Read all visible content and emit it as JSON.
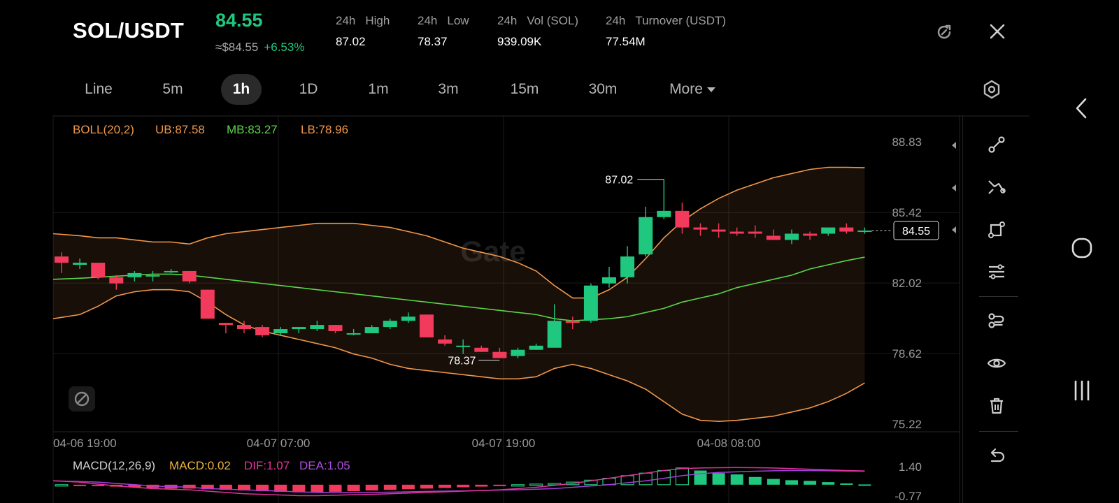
{
  "header": {
    "pair": "SOL/USDT",
    "price": "84.55",
    "approx": "≈$84.55",
    "change": "+6.53%",
    "stats": [
      {
        "period": "24h",
        "label": "High",
        "value": "87.02"
      },
      {
        "period": "24h",
        "label": "Low",
        "value": "78.37"
      },
      {
        "period": "24h",
        "label": "Vol (SOL)",
        "value": "939.09K"
      },
      {
        "period": "24h",
        "label": "Turnover (USDT)",
        "value": "77.54M"
      }
    ]
  },
  "timeframes": [
    "Line",
    "5m",
    "1h",
    "1D",
    "1m",
    "3m",
    "15m",
    "30m",
    "More"
  ],
  "active_timeframe": "1h",
  "indicators": {
    "boll": {
      "name": "BOLL(20,2)",
      "ub": "UB:87.58",
      "mb": "MB:83.27",
      "lb": "LB:78.96"
    },
    "macd": {
      "name": "MACD(12,26,9)",
      "macd": "MACD:0.02",
      "dif": "DIF:1.07",
      "dea": "DEA:1.05"
    }
  },
  "watermark": "Gate",
  "chart_data": {
    "type": "candlestick",
    "y_ticks": [
      "88.83",
      "85.42",
      "82.02",
      "78.62",
      "75.22"
    ],
    "ylim": [
      75.22,
      88.83
    ],
    "x_ticks": [
      "04-06 19:00",
      "04-07 07:00",
      "04-07 19:00",
      "04-08 08:00"
    ],
    "high_marker": "87.02",
    "low_marker": "78.37",
    "last_price_tag": "84.55",
    "macd_ticks": [
      "1.40",
      "-0.77"
    ],
    "candles": [
      [
        83.3,
        83.5,
        82.5,
        83.0
      ],
      [
        82.9,
        83.2,
        82.7,
        83.0
      ],
      [
        83.0,
        83.0,
        82.2,
        82.3
      ],
      [
        82.3,
        82.4,
        81.7,
        82.0
      ],
      [
        82.3,
        82.6,
        82.1,
        82.5
      ],
      [
        82.4,
        82.6,
        82.1,
        82.4
      ],
      [
        82.6,
        82.7,
        82.5,
        82.6
      ],
      [
        82.6,
        82.6,
        82.0,
        82.1
      ],
      [
        81.7,
        81.7,
        80.3,
        80.3
      ],
      [
        80.1,
        80.1,
        79.6,
        80.0
      ],
      [
        80.0,
        80.2,
        79.6,
        79.8
      ],
      [
        79.9,
        80.0,
        79.4,
        79.5
      ],
      [
        79.6,
        79.9,
        79.5,
        79.8
      ],
      [
        79.8,
        79.9,
        79.6,
        79.9
      ],
      [
        79.8,
        80.2,
        79.7,
        80.0
      ],
      [
        80.0,
        80.0,
        79.6,
        79.7
      ],
      [
        79.6,
        79.8,
        79.5,
        79.6
      ],
      [
        79.6,
        80.0,
        79.6,
        79.9
      ],
      [
        79.9,
        80.3,
        79.8,
        80.2
      ],
      [
        80.2,
        80.6,
        80.1,
        80.4
      ],
      [
        80.5,
        80.5,
        79.4,
        79.4
      ],
      [
        79.3,
        79.5,
        79.0,
        79.1
      ],
      [
        79.0,
        79.3,
        78.6,
        79.0
      ],
      [
        78.9,
        79.0,
        78.7,
        78.7
      ],
      [
        78.7,
        78.9,
        78.4,
        78.4
      ],
      [
        78.5,
        78.9,
        78.4,
        78.8
      ],
      [
        78.8,
        79.1,
        78.8,
        79.0
      ],
      [
        78.9,
        81.0,
        78.9,
        80.2
      ],
      [
        80.2,
        80.4,
        79.8,
        80.1
      ],
      [
        80.2,
        82.0,
        80.1,
        81.9
      ],
      [
        82.0,
        82.8,
        81.8,
        82.3
      ],
      [
        82.3,
        83.8,
        82.0,
        83.3
      ],
      [
        83.4,
        85.7,
        83.3,
        85.2
      ],
      [
        85.2,
        87.02,
        85.1,
        85.5
      ],
      [
        85.5,
        85.9,
        84.4,
        84.7
      ],
      [
        84.7,
        84.9,
        84.3,
        84.6
      ],
      [
        84.6,
        84.9,
        84.2,
        84.5
      ],
      [
        84.5,
        84.7,
        84.3,
        84.4
      ],
      [
        84.5,
        84.8,
        84.2,
        84.4
      ],
      [
        84.3,
        84.6,
        84.1,
        84.1
      ],
      [
        84.1,
        84.6,
        83.9,
        84.4
      ],
      [
        84.4,
        84.5,
        84.1,
        84.3
      ],
      [
        84.4,
        84.7,
        84.3,
        84.7
      ],
      [
        84.7,
        84.9,
        84.4,
        84.5
      ],
      [
        84.55,
        84.7,
        84.4,
        84.55
      ]
    ],
    "boll_ub": [
      84.4,
      84.3,
      84.2,
      84.2,
      84.1,
      84.0,
      84.0,
      83.9,
      84.2,
      84.4,
      84.5,
      84.6,
      84.7,
      84.8,
      84.9,
      84.9,
      84.9,
      84.8,
      84.7,
      84.5,
      84.3,
      84.0,
      83.7,
      83.5,
      83.3,
      83.0,
      82.6,
      81.9,
      81.3,
      81.3,
      81.7,
      82.3,
      83.2,
      84.2,
      85.0,
      85.6,
      86.1,
      86.5,
      86.8,
      87.1,
      87.3,
      87.5,
      87.6,
      87.6,
      87.58
    ],
    "boll_mb": [
      82.2,
      82.25,
      82.3,
      82.35,
      82.4,
      82.45,
      82.45,
      82.4,
      82.3,
      82.2,
      82.1,
      82.0,
      81.9,
      81.8,
      81.7,
      81.6,
      81.5,
      81.4,
      81.3,
      81.2,
      81.1,
      81.0,
      80.9,
      80.8,
      80.7,
      80.6,
      80.5,
      80.3,
      80.2,
      80.25,
      80.3,
      80.4,
      80.6,
      80.8,
      81.1,
      81.3,
      81.5,
      81.8,
      82.0,
      82.2,
      82.4,
      82.7,
      82.9,
      83.1,
      83.27
    ],
    "boll_lb": [
      80.3,
      80.5,
      80.9,
      81.4,
      81.6,
      81.7,
      81.7,
      81.6,
      81.1,
      80.5,
      80.0,
      79.7,
      79.5,
      79.3,
      79.1,
      78.9,
      78.6,
      78.4,
      78.1,
      77.9,
      77.8,
      77.7,
      77.6,
      77.5,
      77.4,
      77.4,
      77.5,
      77.9,
      78.1,
      77.9,
      77.6,
      77.3,
      76.9,
      76.3,
      75.7,
      75.4,
      75.35,
      75.4,
      75.5,
      75.6,
      75.8,
      76.0,
      76.3,
      76.7,
      77.2
    ],
    "macd_hist": [
      0.0,
      -0.05,
      -0.1,
      -0.15,
      -0.2,
      -0.25,
      -0.3,
      -0.3,
      -0.35,
      -0.4,
      -0.45,
      -0.5,
      -0.55,
      -0.6,
      -0.6,
      -0.55,
      -0.5,
      -0.45,
      -0.4,
      -0.35,
      -0.3,
      -0.25,
      -0.2,
      -0.15,
      -0.1,
      0.0,
      0.05,
      0.1,
      0.2,
      0.35,
      0.5,
      0.7,
      0.9,
      1.1,
      1.3,
      1.1,
      0.9,
      0.8,
      0.6,
      0.45,
      0.35,
      0.3,
      0.2,
      0.1,
      0.02
    ],
    "macd_dif": [
      0.3,
      0.2,
      0.05,
      -0.1,
      -0.2,
      -0.3,
      -0.35,
      -0.4,
      -0.5,
      -0.6,
      -0.7,
      -0.75,
      -0.8,
      -0.85,
      -0.85,
      -0.82,
      -0.78,
      -0.75,
      -0.7,
      -0.65,
      -0.6,
      -0.55,
      -0.5,
      -0.45,
      -0.4,
      -0.3,
      -0.2,
      -0.05,
      0.1,
      0.3,
      0.5,
      0.7,
      0.9,
      1.1,
      1.25,
      1.3,
      1.32,
      1.33,
      1.32,
      1.3,
      1.25,
      1.2,
      1.15,
      1.1,
      1.07
    ],
    "macd_dea": [
      0.3,
      0.25,
      0.2,
      0.1,
      0.0,
      -0.1,
      -0.15,
      -0.2,
      -0.3,
      -0.35,
      -0.4,
      -0.45,
      -0.5,
      -0.55,
      -0.6,
      -0.62,
      -0.62,
      -0.6,
      -0.58,
      -0.55,
      -0.52,
      -0.5,
      -0.48,
      -0.45,
      -0.42,
      -0.4,
      -0.35,
      -0.3,
      -0.2,
      -0.1,
      0.0,
      0.15,
      0.3,
      0.5,
      0.7,
      0.85,
      0.95,
      1.0,
      1.05,
      1.08,
      1.1,
      1.1,
      1.08,
      1.06,
      1.05
    ]
  },
  "colors": {
    "up": "#20c77f",
    "down": "#f23a5c",
    "boll_band": "#f0974a",
    "boll_mid": "#5bd44a",
    "dif": "#e0339a",
    "dea": "#a43fd8",
    "macd_label": "#f0b33c"
  }
}
